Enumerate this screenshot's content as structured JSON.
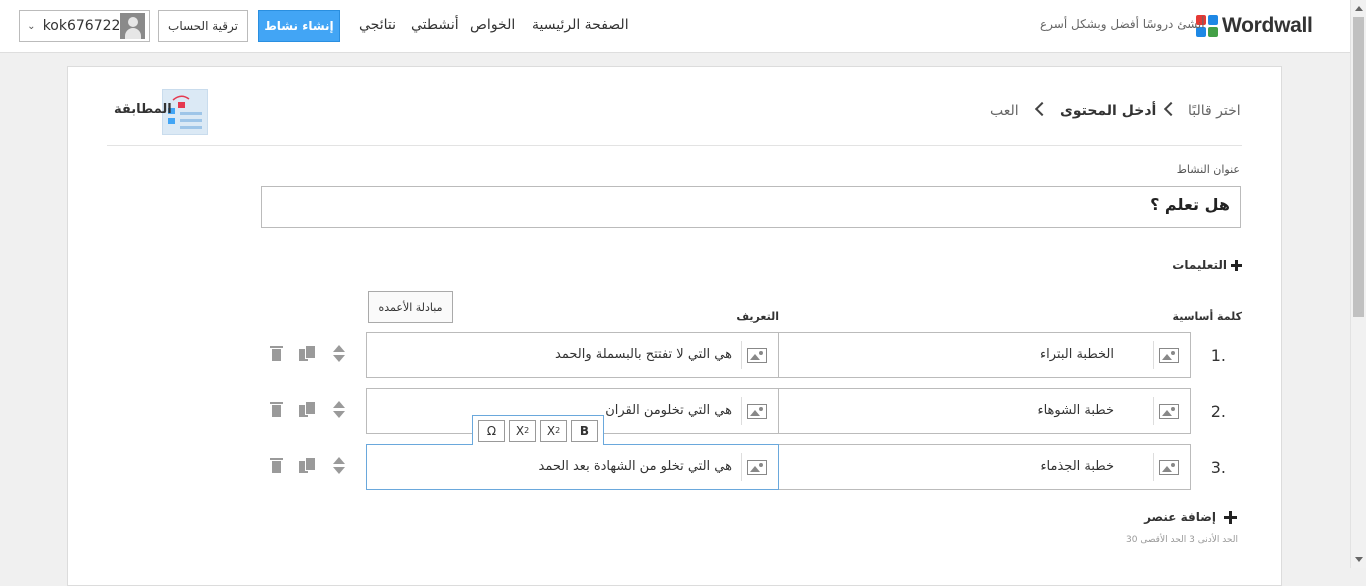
{
  "header": {
    "logo_text": "Wordwall",
    "tagline": "أنشئ دروسًا أفضل وبشكل أسرع",
    "nav": {
      "home": "الصفحة الرئيسية",
      "features": "الخواص",
      "my_activities": "أنشطتي",
      "my_results": "نتائجي"
    },
    "create_button": "إنشاء نشاط",
    "upgrade_button": "ترقية الحساب",
    "username": "kok676722",
    "logo_colors": [
      "#e53935",
      "#1e88e5",
      "#43a047",
      "#1e88e5"
    ]
  },
  "breadcrumb": {
    "step1": "اختر قالبًا",
    "step2": "أدخل المحتوى",
    "step3": "العب"
  },
  "template": {
    "name": "المطابقة"
  },
  "form": {
    "title_label": "عنوان النشاط",
    "title_value": "هل تعلم ؟",
    "instructions_label": "التعليمات",
    "swap_columns": "مبادلة الأعمده",
    "col_keyword": "كلمة أساسية",
    "col_definition": "التعريف",
    "rows": [
      {
        "num": "1.",
        "keyword": "الخطبة البتراء",
        "definition": "هي التي لا تفتتح بالبسملة والحمد"
      },
      {
        "num": "2.",
        "keyword": "خطبة الشوهاء",
        "definition": "هي التي  تخلومن القران"
      },
      {
        "num": "3.",
        "keyword": "خطبة الجذماء",
        "definition": "هي التي تخلو من الشهادة بعد الحمد"
      }
    ],
    "format_toolbar": {
      "omega": "Ω",
      "sub": "X",
      "sub_mark": "2",
      "sup": "X",
      "sup_mark": "2",
      "bold": "B"
    },
    "add_item": "إضافة عنصر",
    "limits": "الحد الأدنى 3   الحد الأقصى 30"
  }
}
